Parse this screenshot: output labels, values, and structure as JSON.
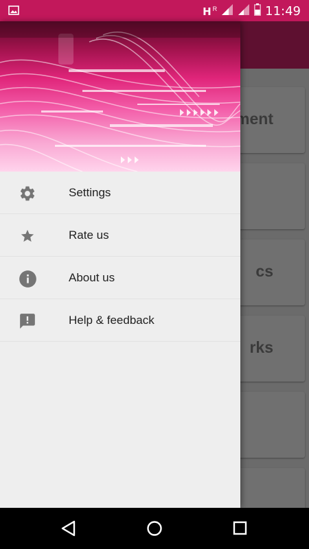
{
  "status_bar": {
    "network_label": "H",
    "roaming_label": "R",
    "time": "11:49"
  },
  "background_app": {
    "cards": [
      {
        "title": "ment"
      },
      {
        "title": ""
      },
      {
        "title": "cs"
      },
      {
        "title": "rks"
      },
      {
        "title": ""
      },
      {
        "title": ""
      }
    ]
  },
  "drawer": {
    "menu": [
      {
        "label": "Settings",
        "icon": "gear-icon"
      },
      {
        "label": "Rate us",
        "icon": "star-icon"
      },
      {
        "label": "About us",
        "icon": "info-icon"
      },
      {
        "label": "Help & feedback",
        "icon": "feedback-icon"
      }
    ]
  },
  "colors": {
    "status_bar": "#c2185b",
    "accent_pink": "#e0257a",
    "icon_gray": "#757575"
  }
}
